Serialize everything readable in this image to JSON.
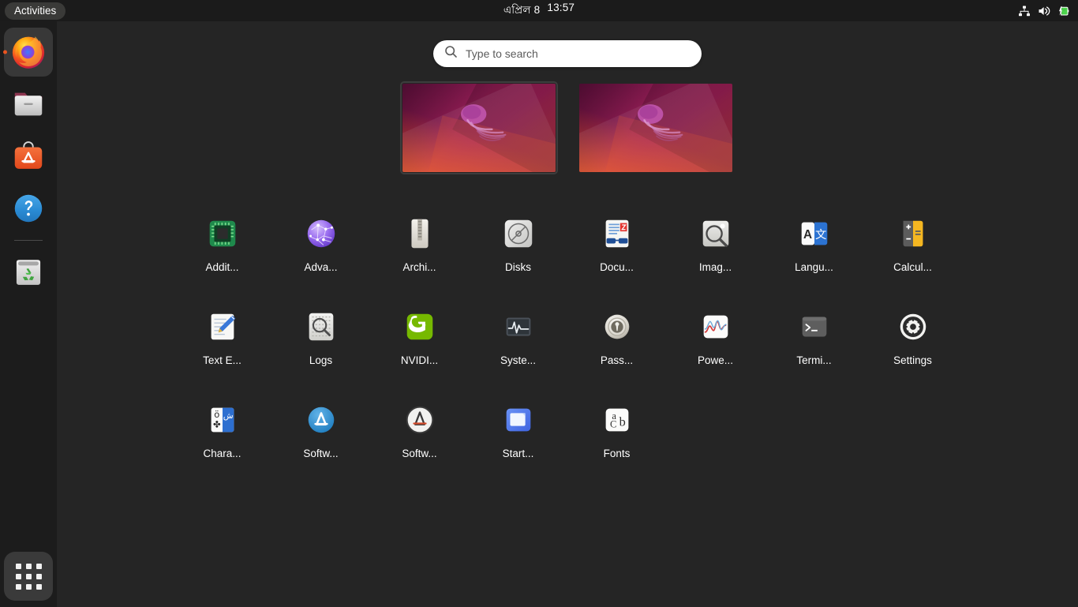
{
  "topbar": {
    "activities_label": "Activities",
    "clock": {
      "date": "এপ্রিল 8",
      "time": "13:57"
    },
    "tray": {
      "network_icon": "network-wired-icon",
      "volume_icon": "volume-high-icon",
      "battery_icon": "battery-charging-icon"
    }
  },
  "dock": {
    "items": [
      {
        "name": "firefox",
        "label": "Firefox Web Browser",
        "icon": "firefox-icon",
        "running": true
      },
      {
        "name": "files",
        "label": "Files",
        "icon": "files-folder-icon",
        "running": false
      },
      {
        "name": "ubuntu-software",
        "label": "Ubuntu Software",
        "icon": "ubuntu-software-icon",
        "running": false
      },
      {
        "name": "help",
        "label": "Help",
        "icon": "help-question-icon",
        "running": false
      },
      {
        "name": "trash",
        "label": "Trash",
        "icon": "trash-recycle-icon",
        "running": false
      }
    ],
    "show_apps_label": "Show Applications",
    "show_apps_icon": "app-grid-icon",
    "accent_color": "#e95420"
  },
  "search": {
    "placeholder": "Type to search",
    "value": "",
    "icon": "search-icon"
  },
  "workspaces": [
    {
      "name": "workspace-1",
      "active": true,
      "wallpaper": "ubuntu-jammy-jellyfish"
    },
    {
      "name": "workspace-2",
      "active": false,
      "wallpaper": "ubuntu-jammy-jellyfish"
    }
  ],
  "apps": [
    {
      "label": "Addit...",
      "icon": "additional-drivers-icon"
    },
    {
      "label": "Adva...",
      "icon": "advanced-network-configuration-icon"
    },
    {
      "label": "Archi...",
      "icon": "archive-manager-icon"
    },
    {
      "label": "Disks",
      "icon": "disks-icon"
    },
    {
      "label": "Docu...",
      "icon": "document-viewer-icon"
    },
    {
      "label": "Imag...",
      "icon": "image-viewer-icon"
    },
    {
      "label": "Langu...",
      "icon": "language-support-icon"
    },
    {
      "label": "Calcul...",
      "icon": "calculator-icon"
    },
    {
      "label": "Text E...",
      "icon": "text-editor-icon"
    },
    {
      "label": "Logs",
      "icon": "logs-icon"
    },
    {
      "label": "NVIDI...",
      "icon": "nvidia-settings-icon"
    },
    {
      "label": "Syste...",
      "icon": "system-monitor-icon"
    },
    {
      "label": "Pass...",
      "icon": "passwords-and-keys-icon"
    },
    {
      "label": "Powe...",
      "icon": "power-statistics-icon"
    },
    {
      "label": "Termi...",
      "icon": "terminal-icon"
    },
    {
      "label": "Settings",
      "icon": "settings-gear-icon"
    },
    {
      "label": "Chara...",
      "icon": "characters-icon"
    },
    {
      "label": "Softw...",
      "icon": "ubuntu-software-icon"
    },
    {
      "label": "Softw...",
      "icon": "software-updater-icon"
    },
    {
      "label": "Start...",
      "icon": "startup-applications-icon"
    },
    {
      "label": "Fonts",
      "icon": "fonts-icon"
    }
  ]
}
